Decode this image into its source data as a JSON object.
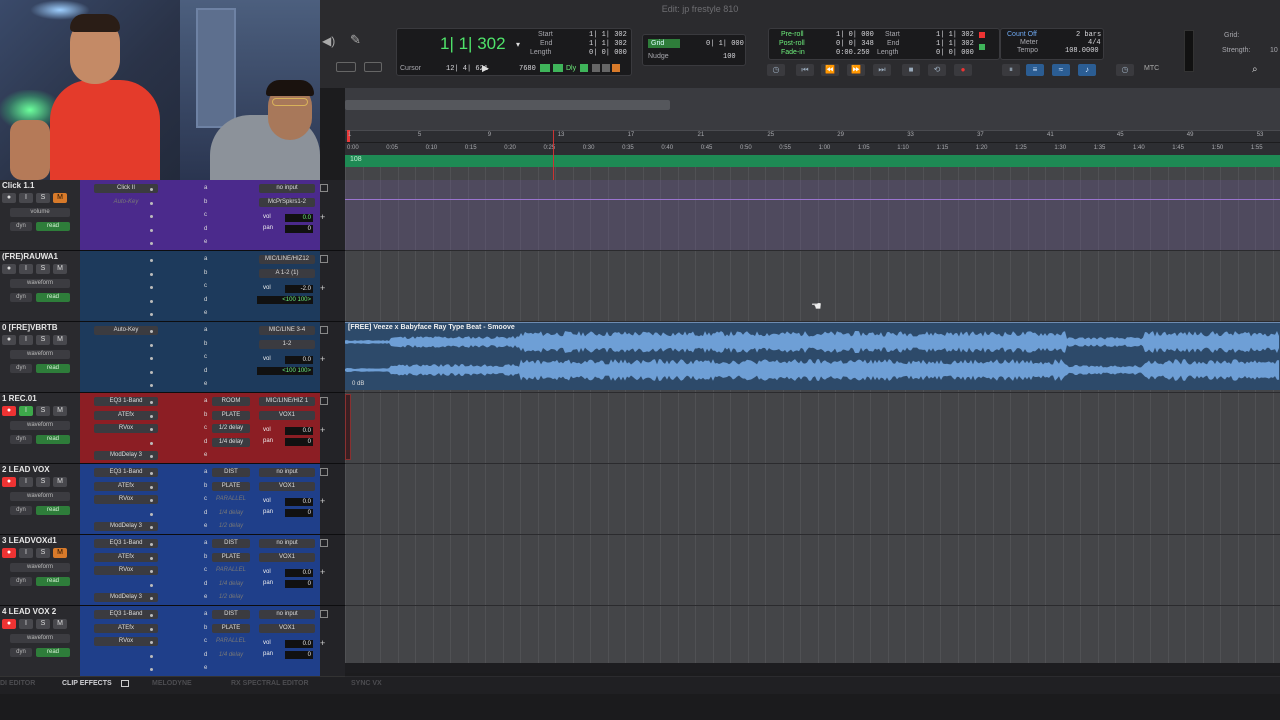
{
  "window": {
    "title": "Edit: jp frestyle 810"
  },
  "counters": {
    "main": "1| 1| 302",
    "cursor_label": "Cursor",
    "cursor_value": "12| 4| 621",
    "start_label": "Start",
    "end_label": "End",
    "length_label": "Length",
    "start": "1| 1| 302",
    "end": "1| 1| 302",
    "length": "0| 0| 000",
    "samplerate": "7680",
    "dly": "Dly"
  },
  "grid": {
    "label": "Grid",
    "value": "0| 1| 000",
    "nudge_label": "Nudge",
    "nudge_value": "100"
  },
  "preroll": {
    "pre_label": "Pre-roll",
    "post_label": "Post-roll",
    "fade_label": "Fade-in",
    "pre": "1| 0| 000",
    "post": "0| 0| 348",
    "fade": "0:00.250",
    "start_label": "Start",
    "end_label": "End",
    "length_label": "Length",
    "start": "1| 1| 302",
    "end": "1| 1| 302",
    "length": "0| 0| 000"
  },
  "countoff": {
    "label": "Count Off",
    "meter_label": "Meter",
    "tempo_label": "Tempo",
    "bars": "2 bars",
    "meter": "4/4",
    "tempo": "108.0000"
  },
  "right_panel": {
    "grid_label": "Grid:",
    "strength_label": "Strength:",
    "strength_value": "10"
  },
  "mtc": "MTC",
  "ruler": {
    "bars": [
      "1",
      "5",
      "9",
      "13",
      "17",
      "21",
      "25",
      "29",
      "33",
      "37",
      "41",
      "45",
      "49",
      "53"
    ],
    "mins": [
      "0:00",
      "0:05",
      "0:10",
      "0:15",
      "0:20",
      "0:25",
      "0:30",
      "0:35",
      "0:40",
      "0:45",
      "0:50",
      "0:55",
      "1:00",
      "1:05",
      "1:10",
      "1:15",
      "1:20",
      "1:25",
      "1:30",
      "1:35",
      "1:40",
      "1:45",
      "1:50",
      "1:55"
    ],
    "marker": "108"
  },
  "tracks": [
    {
      "name": "Click 1.1",
      "mode": "volume",
      "automation": "read",
      "dyn": "dyn",
      "inserts": [
        "Click II",
        "Auto-Key"
      ],
      "sends": [
        "",
        "",
        "",
        "",
        ""
      ],
      "input": "no input",
      "output": "McPrSpkrs1-2",
      "vol": "0.0",
      "pan": "0"
    },
    {
      "name": "(FRE)RAUWA1",
      "mode": "waveform",
      "automation": "read",
      "dyn": "dyn",
      "inserts": [],
      "sends": [
        "",
        "",
        "",
        "",
        ""
      ],
      "input": "MIC/LINE/HIZ12",
      "output": "A 1-2 (1)",
      "vol": "-2.0",
      "pan": "<100   100>"
    },
    {
      "name": "0 [FRE]VBRTB",
      "mode": "waveform",
      "automation": "read",
      "dyn": "dyn",
      "inserts": [
        "Auto-Key"
      ],
      "sends": [
        "",
        "",
        "",
        "",
        ""
      ],
      "input": "MIC/LINE 3-4",
      "output": "1-2",
      "vol": "0.0",
      "pan": "<100   100>"
    },
    {
      "name": "1   REC.01",
      "mode": "waveform",
      "automation": "read",
      "dyn": "dyn",
      "inserts": [
        "EQ3 1-Band",
        "ATEfx",
        "RVox",
        "",
        "ModDelay 3"
      ],
      "sends": [
        "ROOM",
        "PLATE",
        "1/2 delay",
        "1/4 delay",
        ""
      ],
      "input": "MIC/LINE/HIZ 1",
      "output": "VOX1",
      "vol": "0.0",
      "pan": "0"
    },
    {
      "name": "2   LEAD VOX",
      "mode": "waveform",
      "automation": "read",
      "dyn": "dyn",
      "inserts": [
        "EQ3 1-Band",
        "ATEfx",
        "RVox",
        "",
        "ModDelay 3"
      ],
      "sends": [
        "DIST",
        "PLATE",
        "PARALLEL",
        "1/4 delay",
        "1/2 delay"
      ],
      "input": "no input",
      "output": "VOX1",
      "vol": "0.0",
      "pan": "0"
    },
    {
      "name": "3   LEADVOXd1",
      "mode": "waveform",
      "automation": "read",
      "dyn": "dyn",
      "inserts": [
        "EQ3 1-Band",
        "ATEfx",
        "RVox",
        "",
        "ModDelay 3"
      ],
      "sends": [
        "DIST",
        "PLATE",
        "PARALLEL",
        "1/4 delay",
        "1/2 delay"
      ],
      "input": "no input",
      "output": "VOX1",
      "vol": "0.0",
      "pan": "0"
    },
    {
      "name": "4   LEAD VOX 2",
      "mode": "waveform",
      "automation": "read",
      "dyn": "dyn",
      "inserts": [
        "EQ3 1-Band",
        "ATEfx",
        "RVox",
        "",
        ""
      ],
      "sends": [
        "DIST",
        "PLATE",
        "PARALLEL",
        "1/4 delay",
        ""
      ],
      "input": "no input",
      "output": "VOX1",
      "vol": "0.0",
      "pan": "0"
    }
  ],
  "send_letters": [
    "a",
    "b",
    "c",
    "d",
    "e"
  ],
  "vol_label": "vol",
  "pan_label": "pan",
  "clip": {
    "title": "[FREE] Veeze x Babyface Ray Type Beat - Smoove",
    "gain": "0 dB"
  },
  "bottom_tabs": [
    "DI EDITOR",
    "CLIP EFFECTS",
    "MELODYNE",
    "RX SPECTRAL EDITOR",
    "SYNC VX"
  ]
}
